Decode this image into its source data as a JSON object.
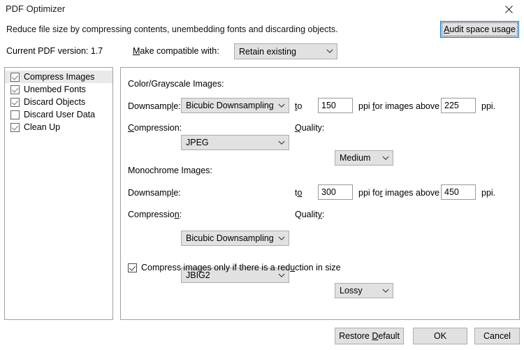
{
  "window": {
    "title": "PDF Optimizer",
    "close_icon": "close-icon"
  },
  "header": {
    "description": "Reduce file size by compressing contents, unembedding fonts and discarding objects.",
    "audit_button": "Audit space usage",
    "audit_button_accel": "A",
    "pdf_version_label": "Current PDF version: 1.7",
    "compatible_label": "Make compatible with:",
    "compatible_accel": "M",
    "compatible_value": "Retain existing"
  },
  "sidebar": {
    "items": [
      {
        "label": "Compress Images",
        "checked": true,
        "selected": true
      },
      {
        "label": "Unembed Fonts",
        "checked": true,
        "selected": false
      },
      {
        "label": "Discard Objects",
        "checked": true,
        "selected": false
      },
      {
        "label": "Discard User Data",
        "checked": false,
        "selected": false
      },
      {
        "label": "Clean Up",
        "checked": true,
        "selected": false
      }
    ]
  },
  "color_section": {
    "title": "Color/Grayscale Images:",
    "downsample_label": "Downsample:",
    "downsample_value": "Bicubic Downsampling",
    "to_label": "to",
    "to_value": "150",
    "ppi_above_label": "ppi for images above",
    "above_value": "225",
    "ppi_suffix": "ppi.",
    "compression_label": "Compression:",
    "compression_value": "JPEG",
    "quality_label": "Quality:",
    "quality_value": "Medium"
  },
  "mono_section": {
    "title": "Monochrome Images:",
    "downsample_label": "Downsample:",
    "downsample_value": "Bicubic Downsampling",
    "to_label": "to",
    "to_value": "300",
    "ppi_above_label": "ppi for images above",
    "above_value": "450",
    "ppi_suffix": "ppi.",
    "compression_label": "Compression:",
    "compression_value": "JBIG2",
    "quality_label": "Quality:",
    "quality_value": "Lossy"
  },
  "bottom_option": {
    "label": "Compress images only if there is a reduction in size",
    "checked": true
  },
  "footer": {
    "restore_default": "Restore Default",
    "ok": "OK",
    "cancel": "Cancel"
  },
  "colors": {
    "focus_border": "#0078d7",
    "control_face": "#e1e1e1",
    "panel_border": "#a0a0a0",
    "selection": "#e9e9e9"
  }
}
